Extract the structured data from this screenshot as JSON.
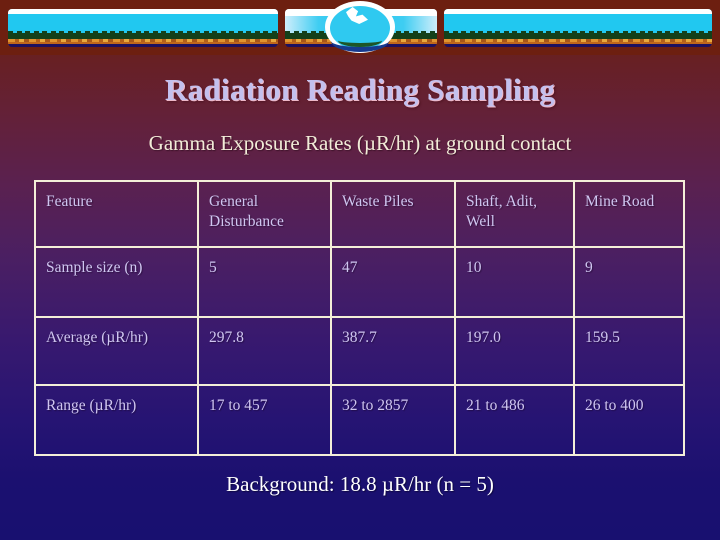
{
  "banner": {
    "segments": [
      "landscape-left",
      "landscape-center",
      "landscape-right"
    ],
    "globe_icon": "globe-icon",
    "sky_color": "#21c8f0",
    "earth_color": "#c0671b",
    "vegetation_color": "#14401a",
    "frame_color": "#6d1f10"
  },
  "slide": {
    "title": "Radiation Reading Sampling",
    "subtitle": "Gamma Exposure Rates (µR/hr) at ground contact",
    "footer": "Background:  18.8 µR/hr (n = 5)",
    "title_color": "#c3c0ee",
    "subtitle_color": "#f2ecd8",
    "footer_color": "#ffffff",
    "background_top": "#6d1f10",
    "background_bottom": "#181070"
  },
  "table": {
    "border_color": "#f4efd8",
    "text_color": "#cfc6f0",
    "headers": [
      "Feature",
      "General Disturbance",
      "Waste Piles",
      "Shaft, Adit, Well",
      "Mine Road"
    ],
    "rows": [
      {
        "label": "Sample size (n)",
        "values": [
          "5",
          "47",
          "10",
          "9"
        ]
      },
      {
        "label": "Average (µR/hr)",
        "values": [
          "297.8",
          "387.7",
          "197.0",
          "159.5"
        ]
      },
      {
        "label": "Range (µR/hr)",
        "values": [
          "17 to 457",
          "32 to 2857",
          "21 to 486",
          "26 to 400"
        ]
      }
    ]
  }
}
